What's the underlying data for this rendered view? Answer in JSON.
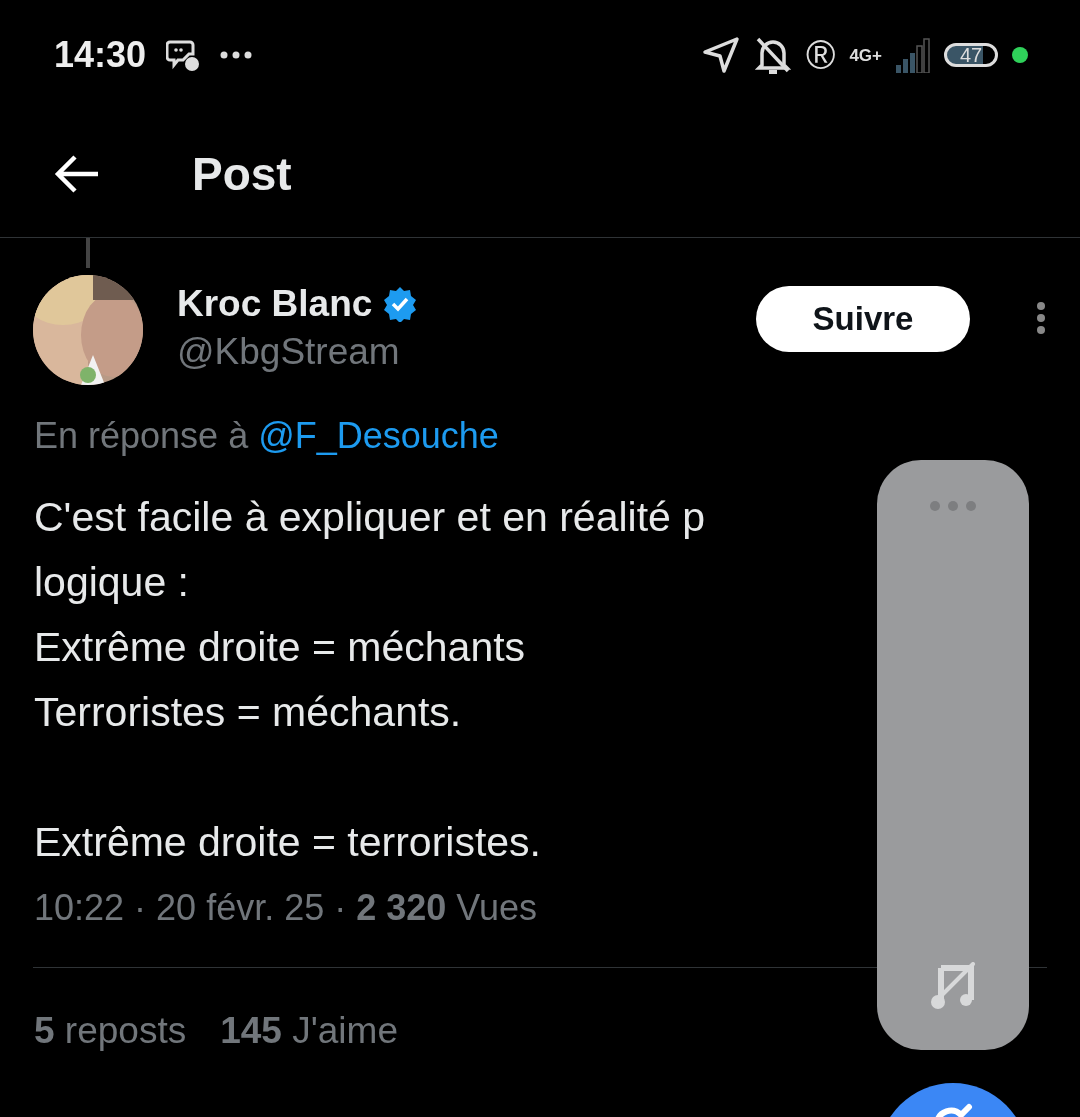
{
  "status_bar": {
    "time": "14:30",
    "registered_mark": "®",
    "network": "4G+",
    "battery": "47"
  },
  "header": {
    "title": "Post"
  },
  "tweet": {
    "author": {
      "name": "Kroc Blanc",
      "verified": true,
      "handle": "@KbgStream"
    },
    "follow_button": "Suivre",
    "reply_to": {
      "prefix": "En réponse à",
      "handle": "@F_Desouche"
    },
    "body": "C'est facile à expliquer et en réalité p\nlogique :\nExtrême droite = méchants\nTerroristes = méchants.\n\nExtrême droite = terroristes.",
    "meta": "10:22 · 20 févr. 25 · **2 320** Vues",
    "stats": [
      "**5** reposts",
      "**145** J'aime"
    ]
  }
}
